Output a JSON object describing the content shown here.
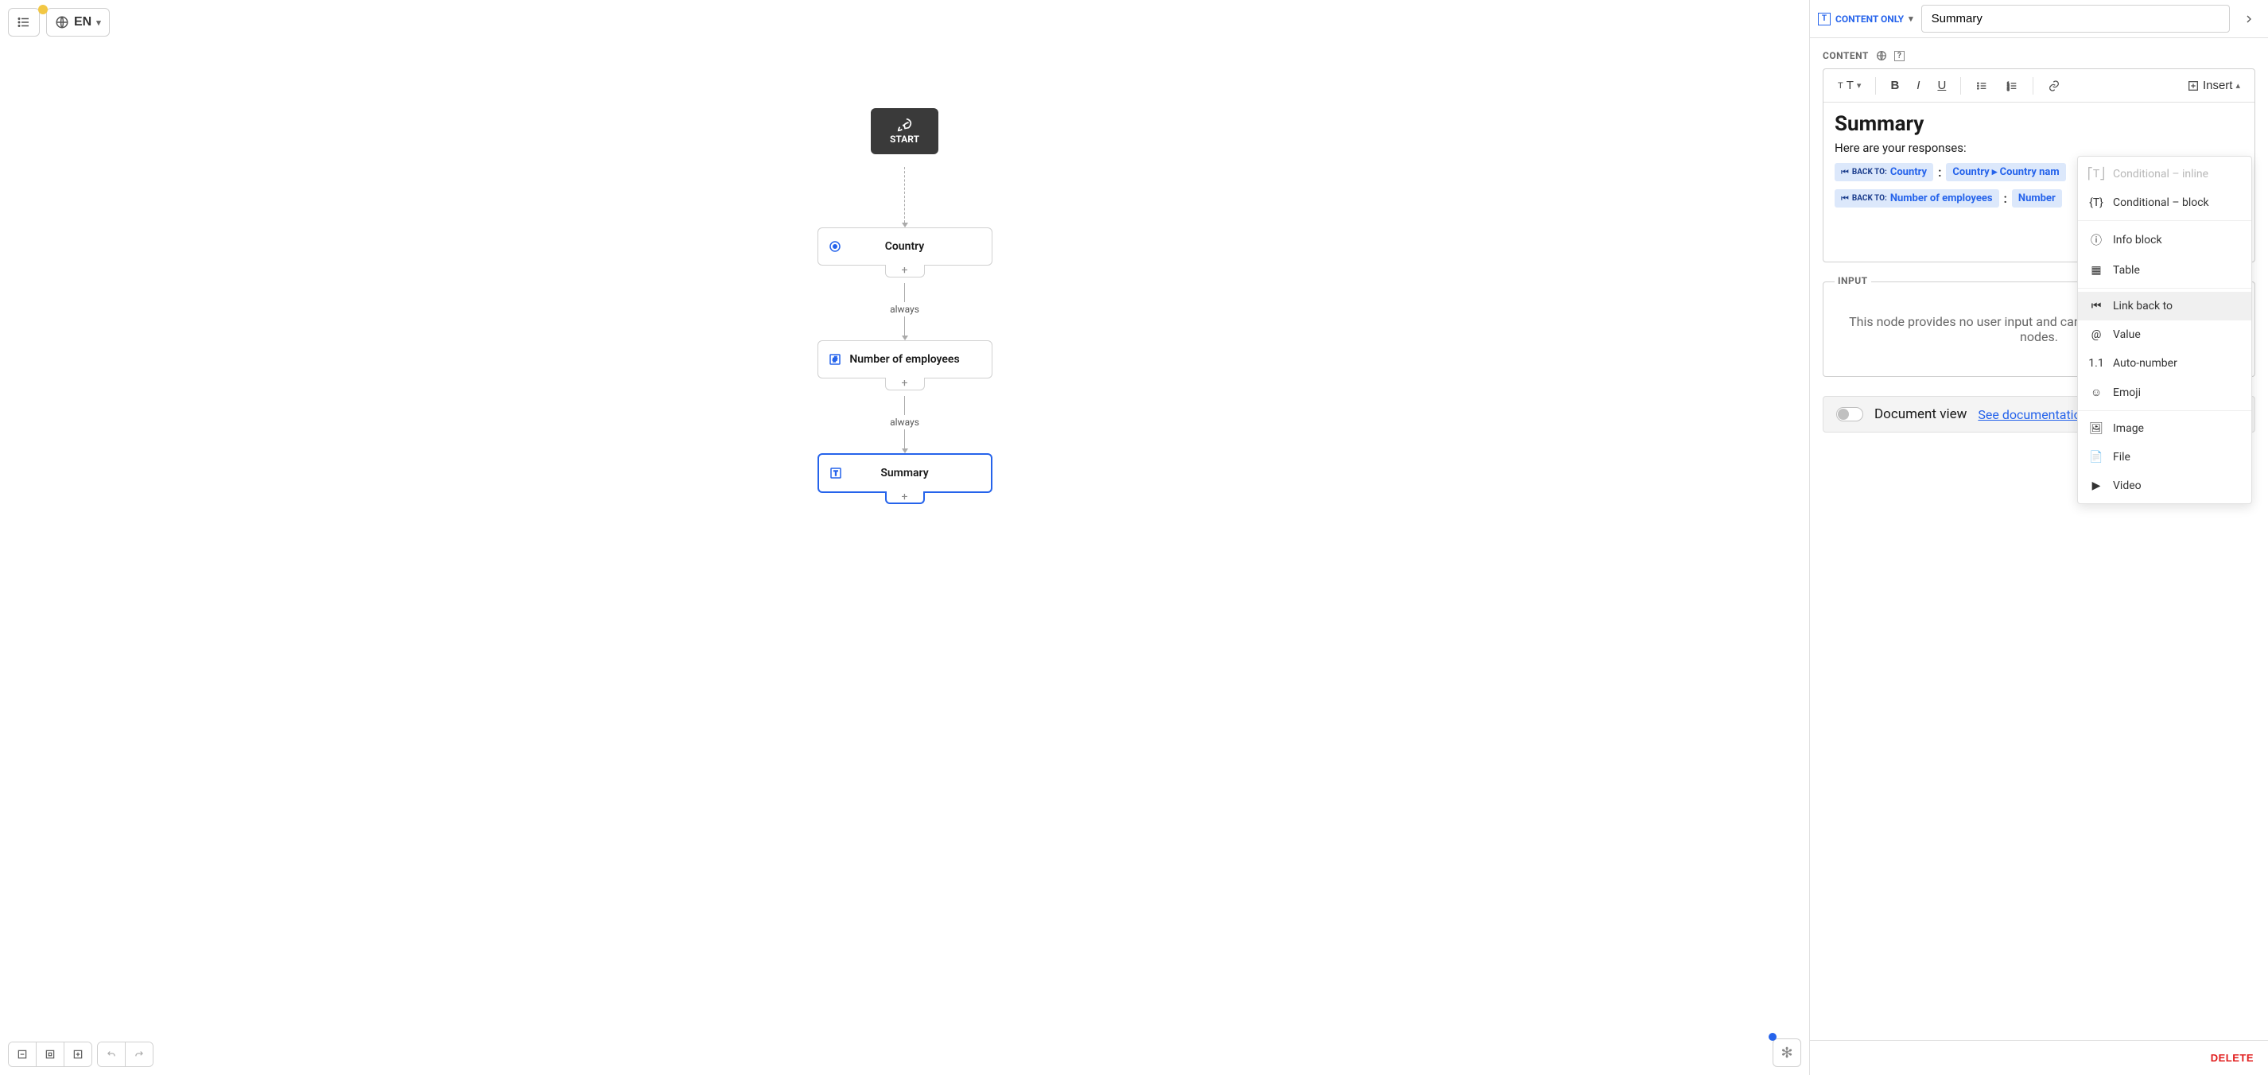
{
  "toolbar": {
    "language": "EN"
  },
  "flow": {
    "start_label": "START",
    "nodes": [
      {
        "title": "Country",
        "icon": "circle-dot"
      },
      {
        "title": "Number of employees",
        "icon": "hash"
      },
      {
        "title": "Summary",
        "icon": "text",
        "selected": true
      }
    ],
    "edges": [
      {
        "label": "",
        "dashed": true
      },
      {
        "label": "always",
        "dashed": false
      },
      {
        "label": "always",
        "dashed": false
      }
    ]
  },
  "panel": {
    "badge_label": "CONTENT ONLY",
    "name_value": "Summary",
    "content_label": "CONTENT",
    "editor": {
      "heading": "Summary",
      "intro": "Here are your responses:",
      "back_to_prefix": "BACK TO:",
      "rows": [
        {
          "back": "Country",
          "value": "Country ▸ Country nam"
        },
        {
          "back": "Number of employees",
          "value": "Number"
        }
      ],
      "colon": ":"
    },
    "insert_label": "Insert",
    "input": {
      "legend": "INPUT",
      "hint": "This node provides no user input and cannot be referenced by other nodes."
    },
    "docview": {
      "label": "Document view",
      "link": "See documentation"
    },
    "delete_label": "DELETE"
  },
  "insert_menu": {
    "items": [
      {
        "label": "Conditional – inline",
        "disabled": true,
        "icon": "⎡T⎦"
      },
      {
        "label": "Conditional – block",
        "icon": "{T}"
      },
      {
        "sep": true
      },
      {
        "label": "Info block",
        "icon": "ⓘ"
      },
      {
        "label": "Table",
        "icon": "▦"
      },
      {
        "sep": true
      },
      {
        "label": "Link back to",
        "icon": "⏮",
        "highlight": true
      },
      {
        "label": "Value",
        "icon": "@"
      },
      {
        "label": "Auto-number",
        "icon": "1.1"
      },
      {
        "label": "Emoji",
        "icon": "☺"
      },
      {
        "sep": true
      },
      {
        "label": "Image",
        "icon": "🖼"
      },
      {
        "label": "File",
        "icon": "📄"
      },
      {
        "label": "Video",
        "icon": "▶"
      }
    ]
  }
}
